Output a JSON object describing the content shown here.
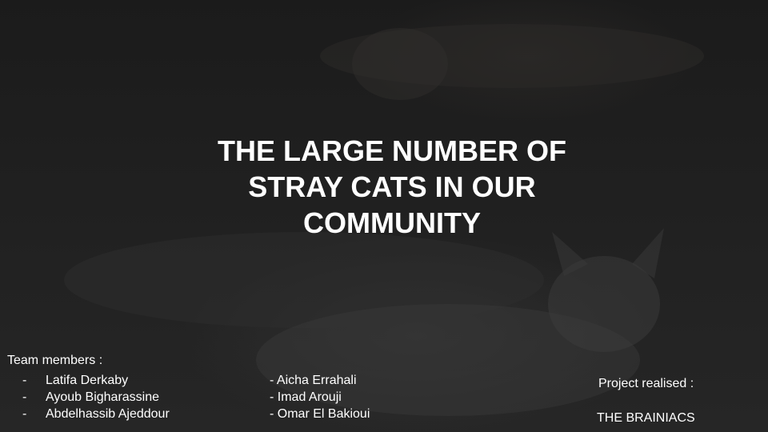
{
  "slide": {
    "title_lines": [
      "THE LARGE NUMBER OF",
      "STRAY CATS IN OUR",
      "COMMUNITY"
    ],
    "team_label": "Team members :",
    "bullet": "-",
    "members_left": [
      "Latifa Derkaby",
      "Ayoub Bigharassine",
      "Abdelhassib Ajeddour"
    ],
    "members_right": [
      "- Aicha Errahali",
      "- Imad Arouji",
      "- Omar El Bakioui"
    ],
    "project_label": "Project realised :",
    "team_name": "THE BRAINIACS"
  },
  "colors": {
    "text": "#ffffff",
    "background": "#1e1e1e"
  },
  "background_image": "dimmed-photo-of-stray-cats"
}
